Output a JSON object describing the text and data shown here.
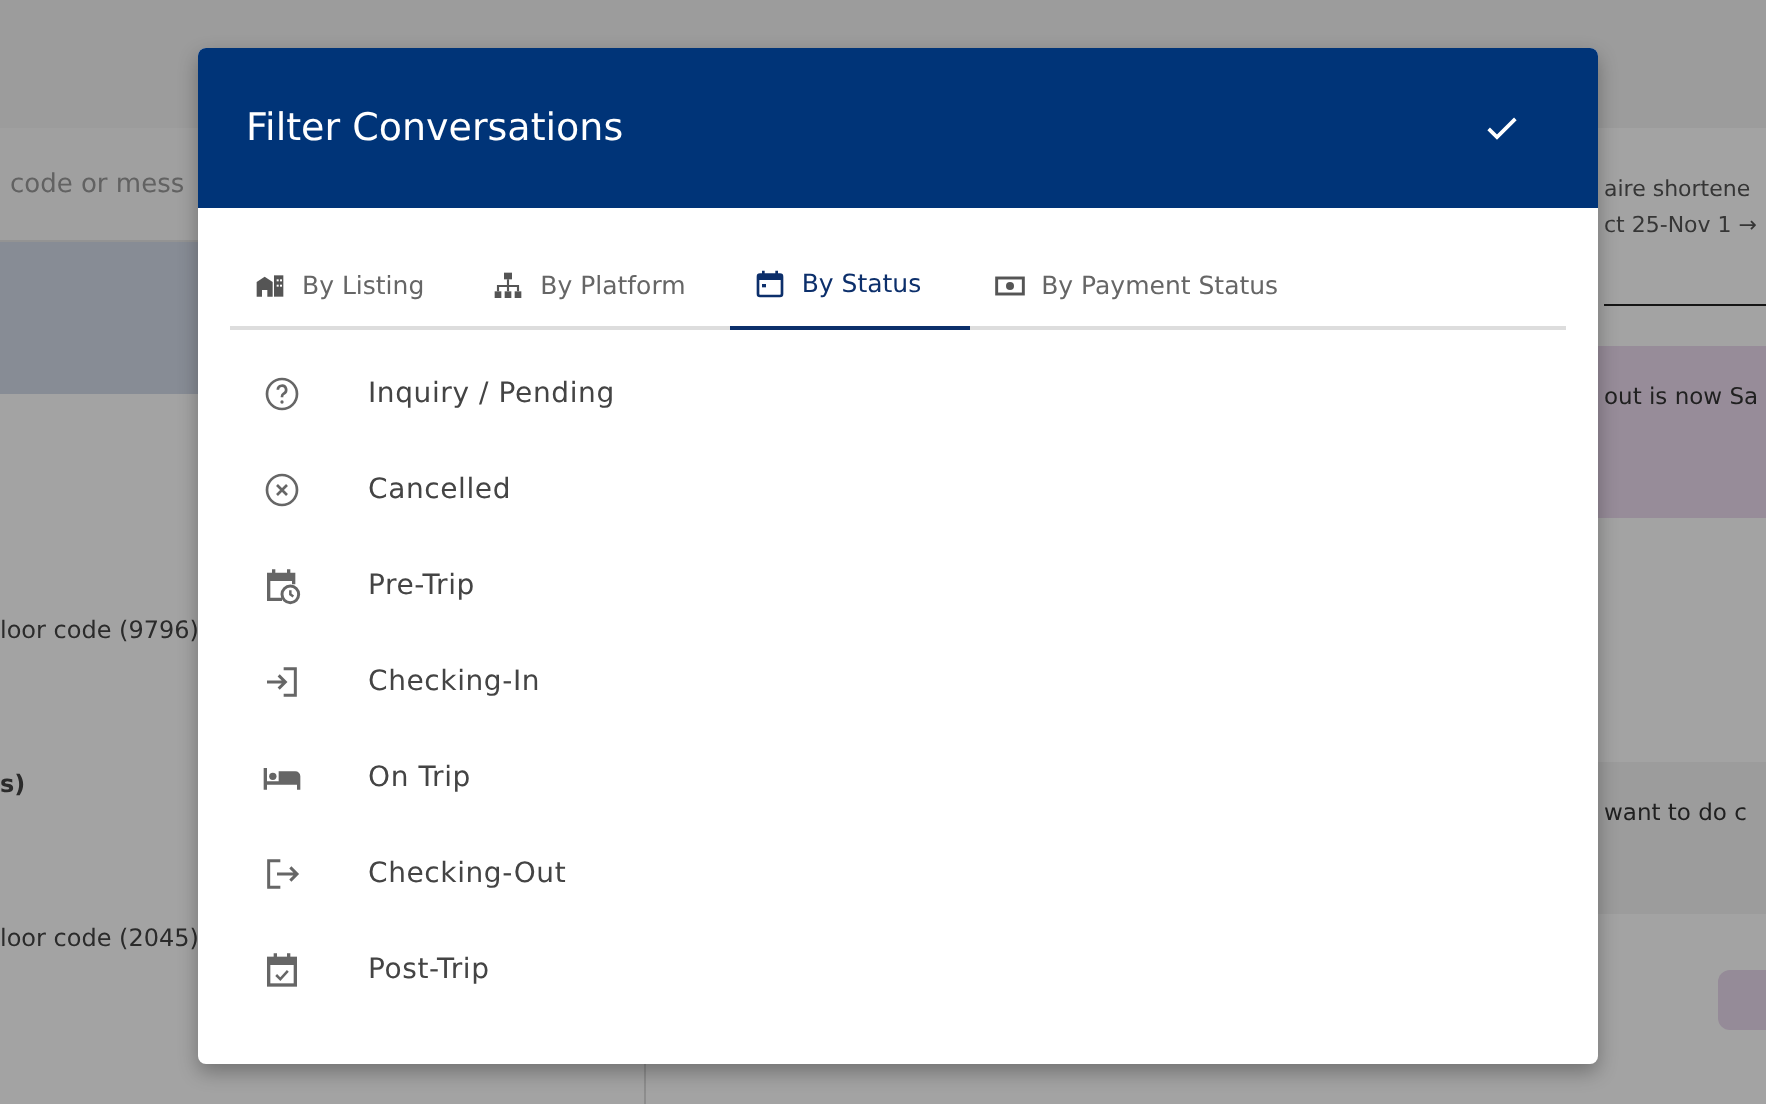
{
  "background": {
    "search": {
      "placeholder": "code or mess"
    },
    "left_rows": [
      {
        "kind": "selected"
      },
      {
        "kind": "text",
        "text": "loor code (9796)"
      },
      {
        "kind": "bold",
        "text": "s)"
      },
      {
        "kind": "text",
        "text": "loor code (2045)"
      }
    ],
    "right_rows": [
      {
        "kind": "header",
        "lines": [
          "aire shortene",
          "ct 25-Nov 1 →"
        ]
      },
      {
        "kind": "bubble_purple",
        "text": "out is now Sa"
      },
      {
        "kind": "bubble_gray",
        "text": "want to do c"
      }
    ]
  },
  "dialog": {
    "title": "Filter Conversations",
    "tabs": [
      {
        "label": "By Listing",
        "selected": false
      },
      {
        "label": "By Platform",
        "selected": false
      },
      {
        "label": "By Status",
        "selected": true
      },
      {
        "label": "By Payment Status",
        "selected": false
      }
    ],
    "statuses": [
      {
        "label": "Inquiry / Pending"
      },
      {
        "label": "Cancelled"
      },
      {
        "label": "Pre-Trip"
      },
      {
        "label": "Checking-In"
      },
      {
        "label": "On Trip"
      },
      {
        "label": "Checking-Out"
      },
      {
        "label": "Post-Trip"
      }
    ]
  }
}
